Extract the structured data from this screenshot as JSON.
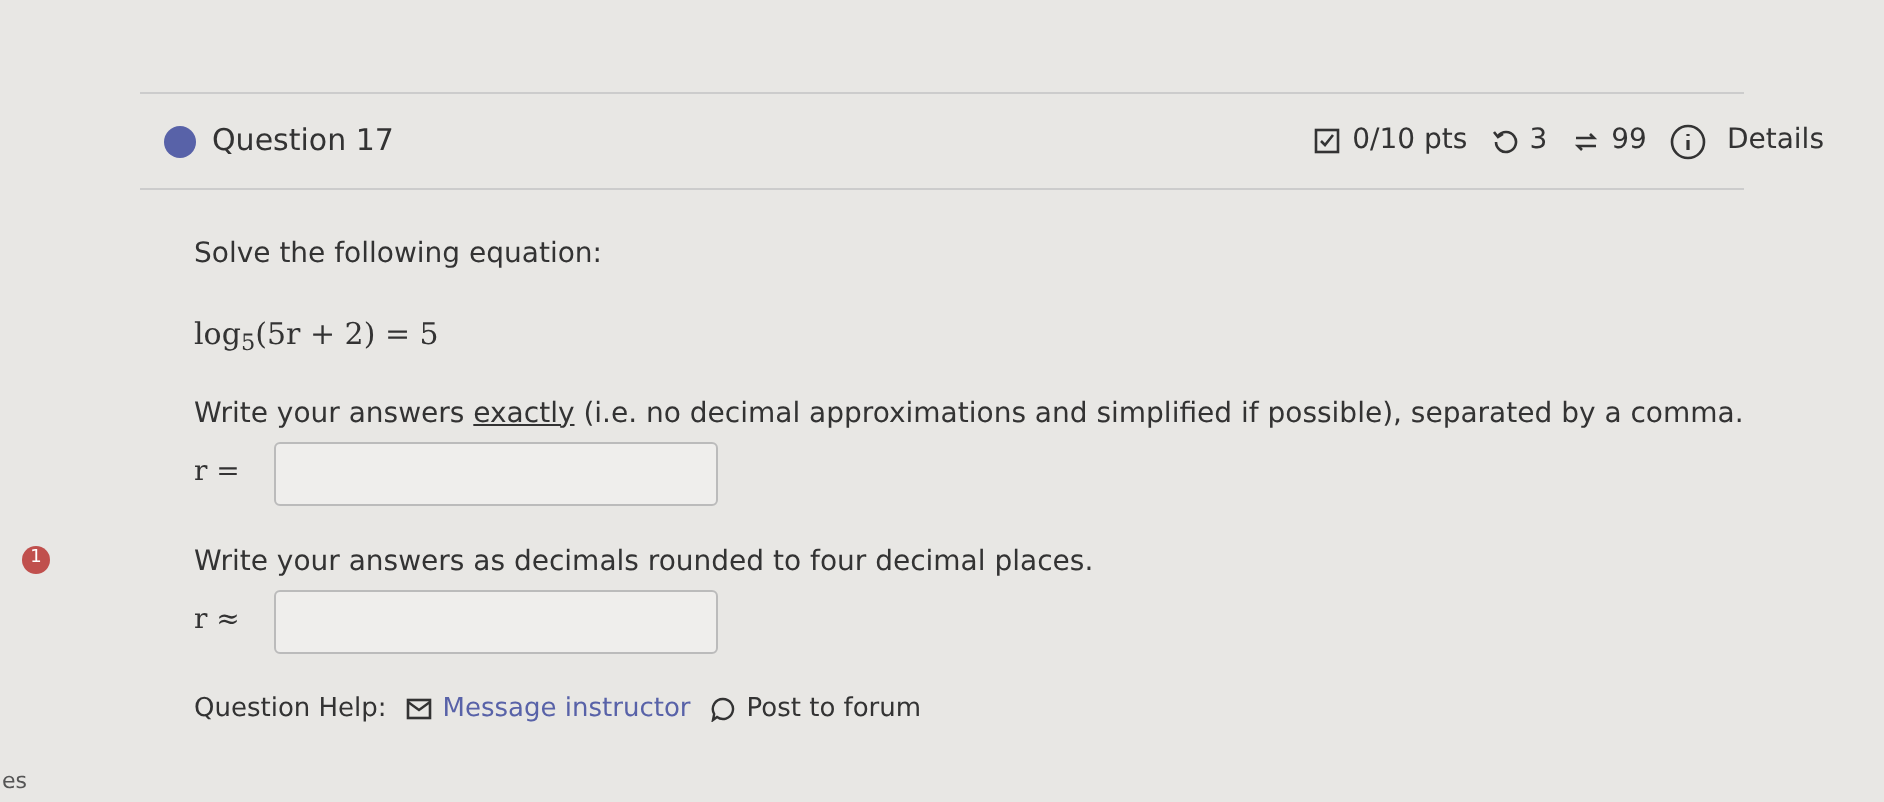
{
  "question": {
    "title": "Question 17",
    "score": "0/10 pts",
    "attempts": "3",
    "submissions": "99",
    "details": "Details"
  },
  "prompt": "Solve the following equation:",
  "equation": "log$_{5}$(5r + 2) = 5",
  "parts": [
    {
      "before": "Write your answers ",
      "emphasis": "exactly",
      "after": " (i.e. no decimal approximations and simplified if possible), separated by a comma.",
      "variable": "r ="
    },
    {
      "badge": "1",
      "before": "Write your answers as decimals rounded to four decimal places.",
      "variable": "r ≈"
    }
  ],
  "help": {
    "label": "Question Help:",
    "links": [
      "Message instructor",
      "Post to forum"
    ]
  },
  "corner_text": "es"
}
